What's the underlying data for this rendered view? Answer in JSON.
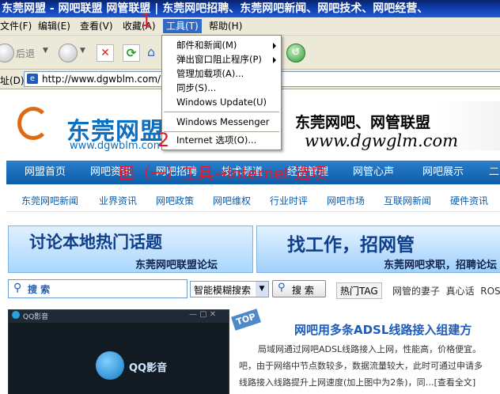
{
  "window": {
    "title": "东莞网盟 - 网吧联盟 网管联盟 | 东莞网吧招聘、东莞网吧新闻、网吧技术、网吧经营、"
  },
  "menubar": {
    "items": [
      "文件(F)",
      "编辑(E)",
      "查看(V)",
      "收藏(A)",
      "工具(T)",
      "帮助(H)"
    ]
  },
  "toolbar": {
    "back_label": "后退"
  },
  "address": {
    "label": "址(D)",
    "url": "http://www.dgwblm.com/index"
  },
  "tools_menu": {
    "items": [
      "邮件和新闻(M)",
      "弹出窗口阻止程序(P)",
      "管理加载项(A)...",
      "同步(S)...",
      "Windows Update(U)",
      "Windows Messenger",
      "Internet 选项(O)..."
    ]
  },
  "annotations": {
    "step1": "1",
    "step2": "2",
    "caption": "图（一）工具→Internet 选项"
  },
  "site": {
    "logo_text": "东莞网盟",
    "logo_url": "www.dgwblm.com",
    "banner_title": "东莞网吧、网管联盟",
    "banner_url": "www.dgwglm.com",
    "nav_main": [
      "网盟首页",
      "网吧资讯",
      "网吧招聘",
      "技术频道",
      "经营管理",
      "网管心声",
      "网吧展示",
      "二"
    ],
    "nav_sub": [
      "东莞网吧新闻",
      "业界资讯",
      "网吧政策",
      "网吧维权",
      "行业时评",
      "网吧市场",
      "互联网新闻",
      "硬件资讯"
    ],
    "ad_left_title": "讨论本地热门话题",
    "ad_left_sub": "东莞网吧联盟论坛",
    "ad_right_title": "找工作，招网管",
    "ad_right_sub": "东莞网吧求职，招聘论坛",
    "search_label": "搜 索",
    "search_select": "智能模糊搜索",
    "search_button": "搜 索",
    "hot_tag": "热门TAG",
    "hot_links": "网管的妻子  真心话  ROS",
    "qq_player_title": "QQ影音",
    "qq_logo": "QQ影音",
    "article_badge": "TOP",
    "article_title": "网吧用多条ADSL线路接入组建方",
    "article_line1": "局域网通过网吧ADSL线路接入上网，性能高，价格便宜。",
    "article_line2": "吧，由于网络中节点数较多，数据流量较大，此时可通过申请多",
    "article_line3": "线路接入线路提升上网速度(加上图中为2条)，同…[查看全文]"
  },
  "colors": {
    "titlebar": "#0b3aa8",
    "highlight": "#316ac5",
    "nav": "#0d5ca8",
    "annotation": "#e8182a"
  }
}
